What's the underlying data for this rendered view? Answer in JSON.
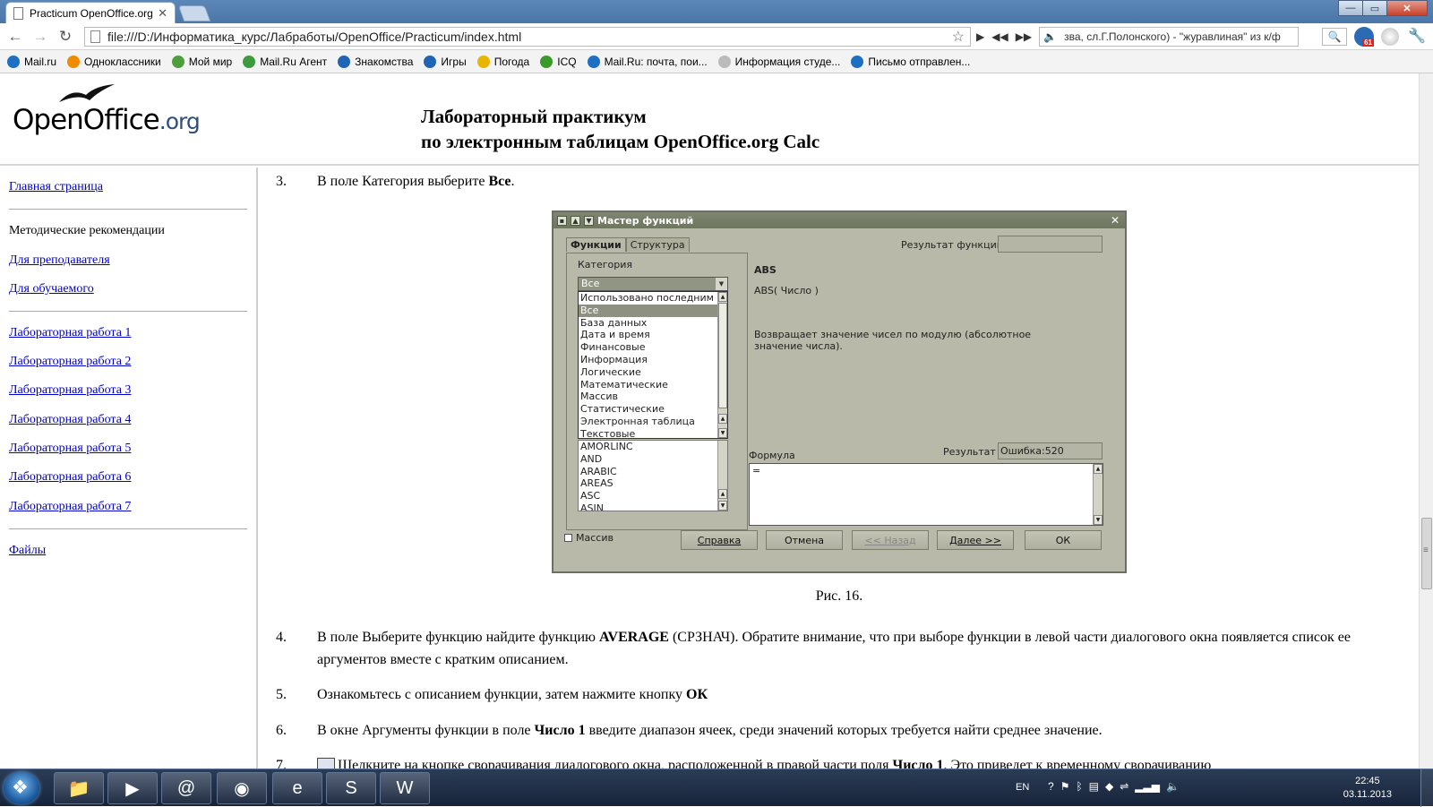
{
  "browser": {
    "tab_title": "Practicum OpenOffice.org",
    "address": "file:///D:/Информатика_курс/Лабработы/OpenOffice/Practicum/index.html",
    "media_text": "зва, сл.Г.Полонского) - \"журавлиная\" из к/ф",
    "ext_badge": "61",
    "window_buttons": [
      "—",
      "▭",
      "✕"
    ],
    "bookmarks": [
      {
        "label": "Mail.ru",
        "color": "#1d6fc4"
      },
      {
        "label": "Одноклассники",
        "color": "#f08a00"
      },
      {
        "label": "Мой мир",
        "color": "#4c9f3a"
      },
      {
        "label": "Mail.Ru Агент",
        "color": "#3c9b3c"
      },
      {
        "label": "Знакомства",
        "color": "#1f64b5"
      },
      {
        "label": "Игры",
        "color": "#1f64b5"
      },
      {
        "label": "Погода",
        "color": "#e8b500"
      },
      {
        "label": "ICQ",
        "color": "#3a9b2a"
      },
      {
        "label": "Mail.Ru: почта, пои...",
        "color": "#1d6fc4"
      },
      {
        "label": "Информация студе...",
        "color": "#bbbbbb"
      },
      {
        "label": "Письмо отправлен...",
        "color": "#1d6fc4"
      }
    ]
  },
  "header": {
    "logo_main": "OpenOffice",
    "logo_org": ".org",
    "title_line1": "Лабораторный практикум",
    "title_line2": "по электронным таблицам OpenOffice.org Calc"
  },
  "sidebar": {
    "home": "Главная страница",
    "methodical": "Методические рекомендации",
    "for_teacher": "Для преподавателя",
    "for_student": "Для обучаемого",
    "labs": [
      "Лабораторная работа 1",
      "Лабораторная работа 2",
      "Лабораторная работа 3",
      "Лабораторная работа 4",
      "Лабораторная работа 5",
      "Лабораторная работа 6",
      "Лабораторная работа 7"
    ],
    "files": "Файлы"
  },
  "content": {
    "step3": {
      "num": "3.",
      "text": "В поле Категория выберите ",
      "bold": "Все",
      "tail": "."
    },
    "caption": "Рис. 16.",
    "step4": {
      "num": "4.",
      "pre": "В поле Выберите функцию найдите функцию ",
      "bold": "AVERAGE",
      "post": " (СРЗНАЧ). Обратите внимание, что при выборе функции в левой части диалогового окна появляется список ее аргументов вместе с кратким описанием."
    },
    "step5": {
      "num": "5.",
      "pre": "Ознакомьтесь с описанием функции, затем нажмите кнопку ",
      "bold": "ОК"
    },
    "step6": {
      "num": "6.",
      "pre": "В окне Аргументы функции в поле ",
      "bold": "Число 1",
      "post": " введите диапазон ячеек, среди значений которых требуется найти среднее значение."
    },
    "step7": {
      "num": "7.",
      "pre": "Щелкните на кнопке сворачивания диалогового окна, расположенной в правой части поля ",
      "bold": "Число 1",
      "post": ". Это приведет к временному сворачиванию"
    }
  },
  "dialog": {
    "title": "Мастер функций",
    "tab_functions": "Функции",
    "tab_structure": "Структура",
    "category_label": "Категория",
    "category_value": "Все",
    "categories": [
      "Использовано последним",
      "Все",
      "База данных",
      "Дата и время",
      "Финансовые",
      "Информация",
      "Логические",
      "Математические",
      "Массив",
      "Статистические",
      "Электронная таблица",
      "Текстовые"
    ],
    "selected_category": "Все",
    "functions": [
      "AMORLINC",
      "AND",
      "ARABIC",
      "AREAS",
      "ASC",
      "ASIN"
    ],
    "result_label": "Результат функции",
    "func_name": "ABS",
    "func_signature": "ABS( Число )",
    "func_description": "Возвращает значение чисел по модулю (абсолютное значение числа).",
    "formula_label": "Формула",
    "result2_label": "Результат",
    "result2_value": "Ошибка:520",
    "formula_value": "=",
    "array_label": "Массив",
    "btn_help": "Справка",
    "btn_cancel": "Отмена",
    "btn_back": "<< Назад",
    "btn_next": "Далее >>",
    "btn_ok": "ОК"
  },
  "taskbar": {
    "lang": "EN",
    "time": "22:45",
    "date": "03.11.2013"
  }
}
